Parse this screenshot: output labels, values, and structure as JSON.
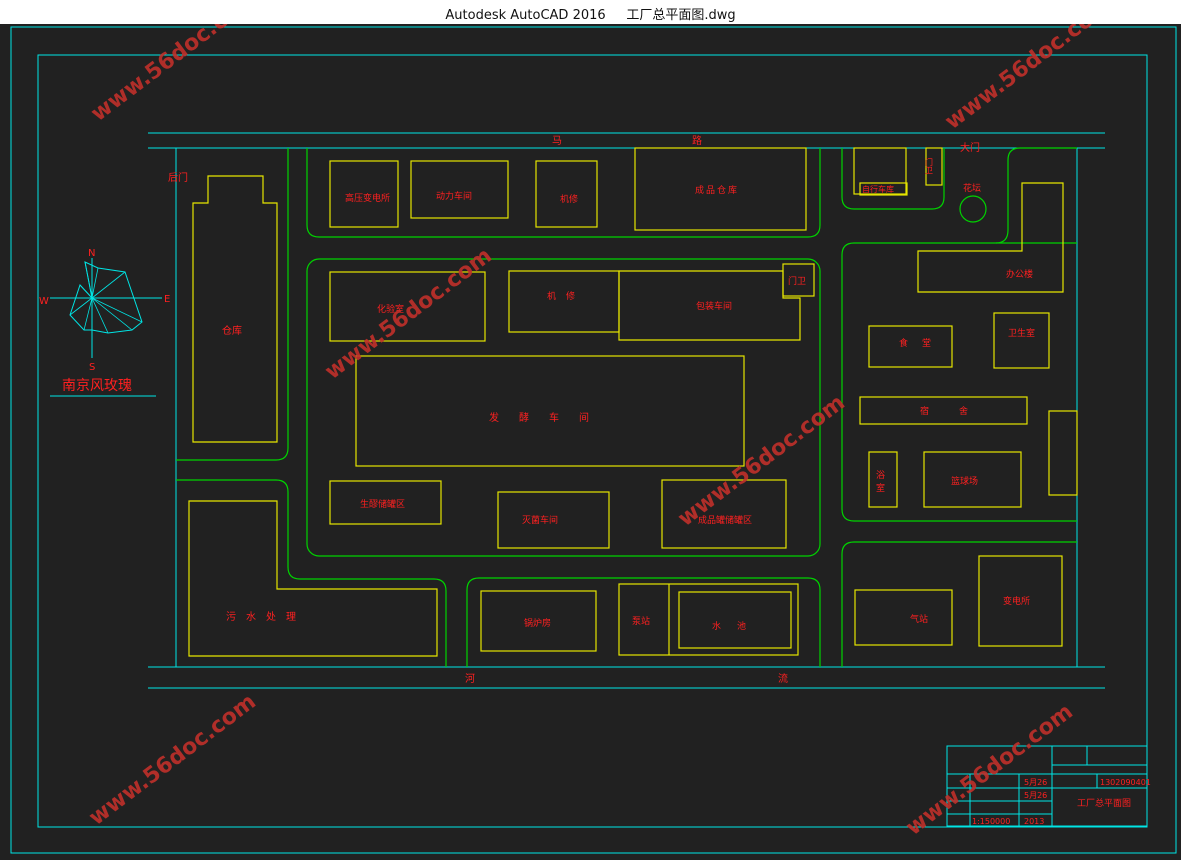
{
  "window": {
    "title": "Autodesk AutoCAD 2016     工厂总平面图.dwg"
  },
  "colors": {
    "background": "#212121",
    "frame": "#00e5e5",
    "building": "#e5e500",
    "road": "#00d200",
    "label": "#ff2020",
    "watermark": "#c0302a"
  },
  "drawing": {
    "roads": {
      "top_road_a": "马",
      "top_road_b": "路",
      "river_a": "河",
      "river_b": "流"
    },
    "gates": {
      "back_gate": "后门",
      "main_gate": "大门"
    },
    "buildings": {
      "warehouse": "仓库",
      "hv_substation": "高压变电所",
      "power_workshop": "动力车间",
      "machine_repair_top": "机修",
      "finished_warehouse": "成品仓库",
      "bike_shed": "自行车库",
      "gatehouse_top": "门卫",
      "garden": "花坛",
      "office": "办公楼",
      "chem_lab": "化验室",
      "machine_repair": "机修",
      "packaging_workshop": "包装车间",
      "gatehouse": "门卫",
      "canteen": "食堂",
      "clinic": "卫生室",
      "fermentation_workshop": "发酵车间",
      "dormitory": "宿舍",
      "raw_tank_area": "生醪储罐区",
      "sterilization_workshop": "灭菌车间",
      "product_tank_area": "成品罐储罐区",
      "bathroom": "浴室",
      "basketball_court": "篮球场",
      "sewage_treatment": "污水处理",
      "boiler_room": "锅炉房",
      "pump_station": "泵站",
      "water_pool": "水池",
      "gas_station": "气站",
      "substation": "变电所"
    },
    "wind_rose": {
      "north": "N",
      "south": "S",
      "east": "E",
      "west": "W",
      "caption": "南京风玫瑰"
    },
    "title_block": {
      "drawing_name": "工厂总平面图",
      "number": "1302090401",
      "scale": "1:150000",
      "year": "2013",
      "date_1": "5月26",
      "date_2": "5月26"
    }
  },
  "watermark": {
    "text": "www.56doc.com"
  }
}
